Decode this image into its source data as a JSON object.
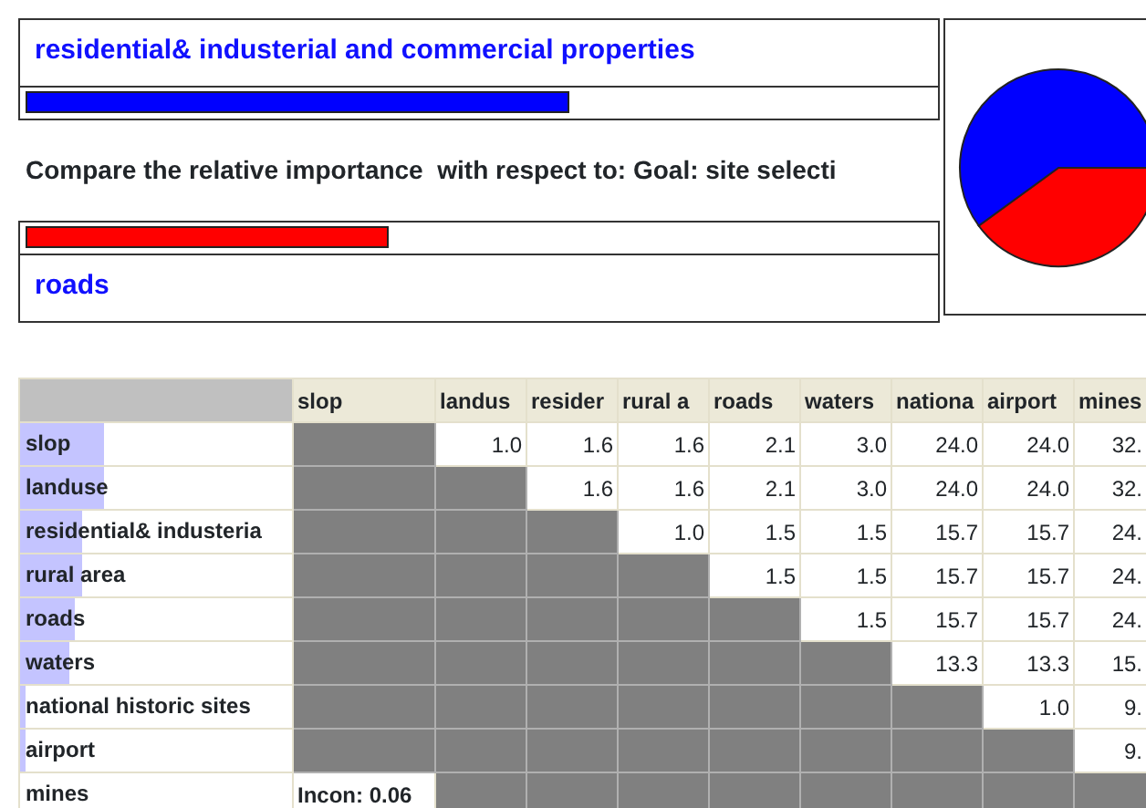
{
  "comparison": {
    "items": [
      {
        "label": "residential& industerial and commercial properties",
        "color": "#0000ff",
        "level": 0.6
      },
      {
        "label": "roads",
        "color": "#ff0000",
        "level": 0.4
      }
    ],
    "question": "Compare the relative importance  with respect to: Goal: site selecti"
  },
  "matrix": {
    "columns": [
      "slop",
      "landus",
      "resider",
      "rural a",
      "roads",
      "waters",
      "nationa",
      "airport",
      "mines"
    ],
    "rows": [
      {
        "label": "slop",
        "level": 0.31,
        "cells": [
          null,
          "1.0",
          "1.6",
          "1.6",
          "2.1",
          "3.0",
          "24.0",
          "24.0",
          "32."
        ]
      },
      {
        "label": "landuse",
        "level": 0.31,
        "cells": [
          null,
          null,
          "1.6",
          "1.6",
          "2.1",
          "3.0",
          "24.0",
          "24.0",
          "32."
        ]
      },
      {
        "label": "residential& industeria",
        "level": 0.23,
        "cells": [
          null,
          null,
          null,
          "1.0",
          "1.5",
          "1.5",
          "15.7",
          "15.7",
          "24."
        ]
      },
      {
        "label": "rural area",
        "level": 0.23,
        "cells": [
          null,
          null,
          null,
          null,
          "1.5",
          "1.5",
          "15.7",
          "15.7",
          "24."
        ]
      },
      {
        "label": "roads",
        "level": 0.2,
        "cells": [
          null,
          null,
          null,
          null,
          null,
          "1.5",
          "15.7",
          "15.7",
          "24."
        ]
      },
      {
        "label": "waters",
        "level": 0.18,
        "cells": [
          null,
          null,
          null,
          null,
          null,
          null,
          "13.3",
          "13.3",
          "15."
        ]
      },
      {
        "label": "national historic sites",
        "level": 0.02,
        "cells": [
          null,
          null,
          null,
          null,
          null,
          null,
          null,
          "1.0",
          "9."
        ]
      },
      {
        "label": "airport",
        "level": 0.02,
        "cells": [
          null,
          null,
          null,
          null,
          null,
          null,
          null,
          null,
          "9."
        ]
      },
      {
        "label": "mines",
        "cells": [
          "Incon: 0.06",
          null,
          null,
          null,
          null,
          null,
          null,
          null,
          null
        ]
      }
    ]
  }
}
